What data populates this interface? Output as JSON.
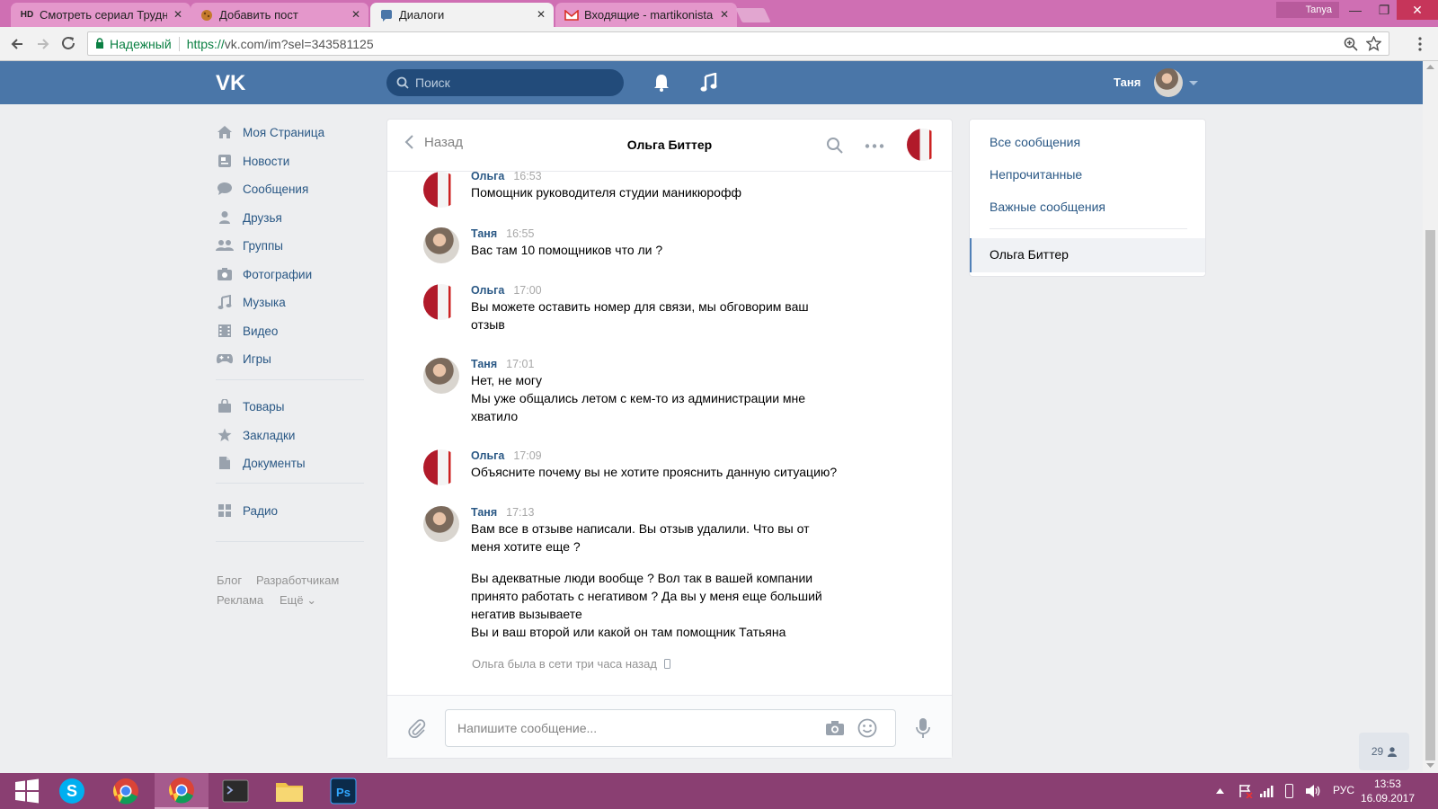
{
  "browser": {
    "tabs": [
      {
        "label": "Смотреть сериал Трудн",
        "favicon": "HD"
      },
      {
        "label": "Добавить пост",
        "favicon": "cookie-icon"
      },
      {
        "label": "Диалоги",
        "favicon": "vk-message-icon"
      },
      {
        "label": "Входящие - martikonista",
        "favicon": "gmail-icon"
      }
    ],
    "profile_name": "Tanya",
    "secure_label": "Надежный",
    "url_protocol": "https://",
    "url_rest": "vk.com/im?sel=343581125"
  },
  "vk_header": {
    "search_placeholder": "Поиск",
    "user_name": "Таня"
  },
  "left_menu": {
    "items": [
      {
        "label": "Моя Страница",
        "icon": "home-icon"
      },
      {
        "label": "Новости",
        "icon": "news-icon"
      },
      {
        "label": "Сообщения",
        "icon": "messages-icon"
      },
      {
        "label": "Друзья",
        "icon": "friends-icon"
      },
      {
        "label": "Группы",
        "icon": "groups-icon"
      },
      {
        "label": "Фотографии",
        "icon": "photos-icon"
      },
      {
        "label": "Музыка",
        "icon": "music-icon"
      },
      {
        "label": "Видео",
        "icon": "video-icon"
      },
      {
        "label": "Игры",
        "icon": "games-icon"
      },
      {
        "label": "Товары",
        "icon": "goods-icon"
      },
      {
        "label": "Закладки",
        "icon": "bookmarks-icon"
      },
      {
        "label": "Документы",
        "icon": "documents-icon"
      },
      {
        "label": "Радио",
        "icon": "radio-icon"
      }
    ],
    "footer": {
      "blog": "Блог",
      "dev": "Разработчикам",
      "ads": "Реклама",
      "more": "Ещё"
    }
  },
  "chat": {
    "back_label": "Назад",
    "title": "Ольга Биттер",
    "messages": [
      {
        "author": "Ольга",
        "time": "16:53",
        "lines": [
          "Помощник руководителя студии маникюрофф"
        ]
      },
      {
        "author": "Таня",
        "time": "16:55",
        "lines": [
          "Вас там 10 помощников что ли ?"
        ]
      },
      {
        "author": "Ольга",
        "time": "17:00",
        "lines": [
          "Вы можете оставить номер для связи, мы обговорим ваш",
          "отзыв"
        ]
      },
      {
        "author": "Таня",
        "time": "17:01",
        "lines": [
          "Нет, не могу",
          "Мы уже общались летом с кем-то из администрации мне",
          "хватило"
        ]
      },
      {
        "author": "Ольга",
        "time": "17:09",
        "lines": [
          "Объясните почему вы не хотите прояснить данную ситуацию?"
        ]
      },
      {
        "author": "Таня",
        "time": "17:13",
        "lines": [
          "Вам все в отзыве написали. Вы отзыв удалили. Что вы от",
          "меня хотите еще ?",
          "Вы адекватные люди вообще ? Вол так в вашей компании",
          "принято работать с негативом ? Да вы у меня еще больший",
          "негатив вызываете",
          "Вы и ваш второй или какой он там помощник Татьяна"
        ]
      }
    ],
    "status": "Ольга была в сети три часа назад",
    "input_placeholder": "Напишите сообщение..."
  },
  "right_panel": {
    "all": "Все сообщения",
    "unread": "Непрочитанные",
    "important": "Важные сообщения",
    "active_dialog": "Ольга Биттер"
  },
  "online_count": "29",
  "taskbar": {
    "apps": [
      "windows-start-icon",
      "skype-icon",
      "chrome-icon",
      "chrome-icon",
      "terminal-icon",
      "folder-icon",
      "photoshop-icon"
    ],
    "lang": "РУС",
    "time": "13:53",
    "date": "16.09.2017"
  },
  "colors": {
    "vk_blue": "#4a76a8",
    "link": "#2a5885",
    "taskbar": "#8a3f72",
    "tabstrip": "#cf6fb3"
  }
}
